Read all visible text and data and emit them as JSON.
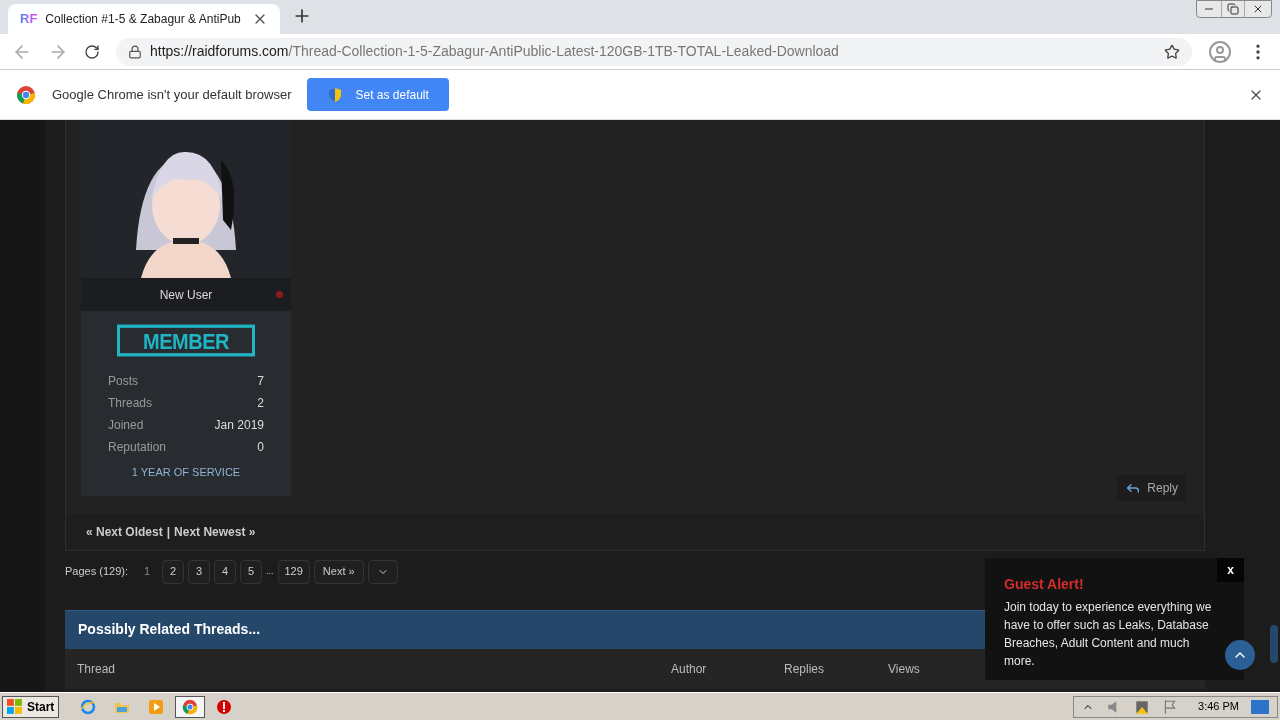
{
  "browser": {
    "tab_logo": "RF",
    "tab_title": "Collection #1-5 & Zabagur & AntiPub",
    "url_host": "https://raidforums.com",
    "url_path": "/Thread-Collection-1-5-Zabagur-AntiPublic-Latest-120GB-1TB-TOTAL-Leaked-Download"
  },
  "infobar": {
    "message": "Google Chrome isn't your default browser",
    "button": "Set as default"
  },
  "profile": {
    "title": "New User",
    "online": false,
    "rank": "MEMBER",
    "service": "1 YEAR OF SERVICE",
    "stats": [
      {
        "label": "Posts",
        "value": "7"
      },
      {
        "label": "Threads",
        "value": "2"
      },
      {
        "label": "Joined",
        "value": "Jan 2019"
      },
      {
        "label": "Reputation",
        "value": "0"
      }
    ]
  },
  "reply_button": "Reply",
  "thread_nav": {
    "older": "« Next Oldest",
    "separator": "|",
    "newer": "Next Newest »"
  },
  "pagination": {
    "label": "Pages (129):",
    "items": [
      {
        "kind": "page",
        "label": "1",
        "selected": true
      },
      {
        "kind": "page",
        "label": "2",
        "selected": false
      },
      {
        "kind": "page",
        "label": "3",
        "selected": false
      },
      {
        "kind": "page",
        "label": "4",
        "selected": false
      },
      {
        "kind": "page",
        "label": "5",
        "selected": false
      },
      {
        "kind": "ellipsis",
        "label": "..."
      },
      {
        "kind": "page",
        "label": "129",
        "selected": false
      },
      {
        "kind": "next",
        "label": "Next »"
      }
    ]
  },
  "related": {
    "title": "Possibly Related Threads...",
    "columns": [
      "Thread",
      "Author",
      "Replies",
      "Views"
    ]
  },
  "guest_alert": {
    "title": "Guest Alert!",
    "message": "Join today to experience everything we have to offer such as Leaks, Database Breaches, Adult Content and much more.",
    "close": "x"
  },
  "taskbar": {
    "start": "Start",
    "clock": "3:46 PM",
    "apps": [
      {
        "kind": "ie",
        "selected": false
      },
      {
        "kind": "folder",
        "selected": false
      },
      {
        "kind": "media",
        "selected": false
      },
      {
        "kind": "chrome",
        "selected": true
      },
      {
        "kind": "stop",
        "selected": false
      }
    ]
  }
}
